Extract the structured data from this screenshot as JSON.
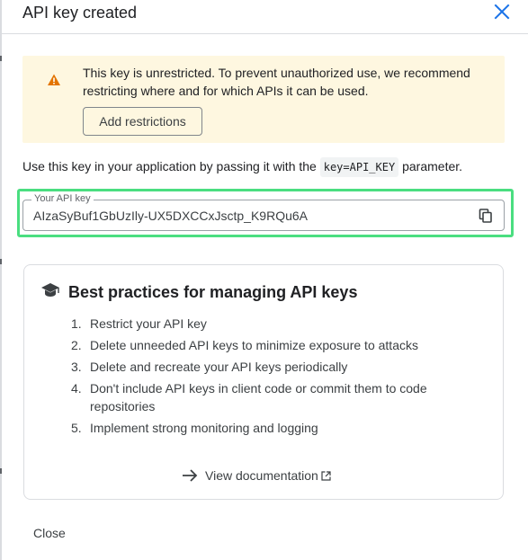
{
  "dialog": {
    "title": "API key created"
  },
  "warning": {
    "text": "This key is unrestricted. To prevent unauthorized use, we recommend restricting where and for which APIs it can be used.",
    "button_label": "Add restrictions"
  },
  "usage": {
    "prefix": "Use this key in your application by passing it with the",
    "code": "key=API_KEY",
    "suffix": "parameter."
  },
  "api_key": {
    "label": "Your API key",
    "value": "AIzaSyBuf1GbUzIly-UX5DXCCxJsctp_K9RQu6A"
  },
  "best_practices": {
    "title": "Best practices for managing API keys",
    "items": [
      {
        "num": "1.",
        "text": "Restrict your API key"
      },
      {
        "num": "2.",
        "text": "Delete unneeded API keys to minimize exposure to attacks"
      },
      {
        "num": "3.",
        "text": "Delete and recreate your API keys periodically"
      },
      {
        "num": "4.",
        "text": "Don't include API keys in client code or commit them to code repositories"
      },
      {
        "num": "5.",
        "text": "Implement strong monitoring and logging"
      }
    ],
    "link_label": "View documentation"
  },
  "footer": {
    "close_label": "Close"
  },
  "colors": {
    "accent": "#1a73e8",
    "warning_bg": "#fef7e0",
    "warning_icon": "#e37400",
    "highlight": "#4ade80"
  }
}
